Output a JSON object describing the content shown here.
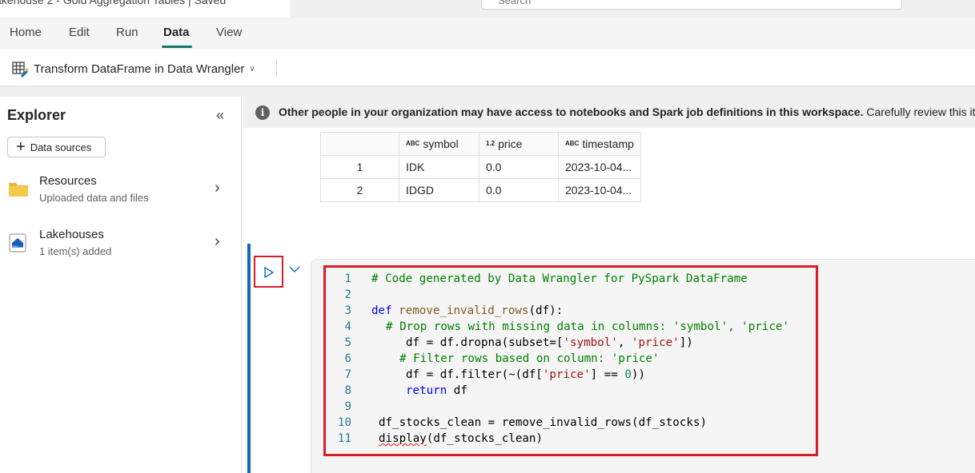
{
  "window": {
    "title_partial": "akehouse 2 - Gold Aggregation Tables | Saved",
    "search_placeholder": "Search"
  },
  "menu": {
    "tabs": [
      "Home",
      "Edit",
      "Run",
      "Data",
      "View"
    ],
    "active": "Data"
  },
  "ribbon": {
    "transform_button": "Transform DataFrame in Data Wrangler"
  },
  "explorer": {
    "title": "Explorer",
    "data_sources_label": "Data sources",
    "items": [
      {
        "label": "Resources",
        "sub": "Uploaded data and files",
        "icon": "folder-icon"
      },
      {
        "label": "Lakehouses",
        "sub": "1 item(s) added",
        "icon": "lakehouse-icon"
      }
    ]
  },
  "infobar": {
    "bold_text": "Other people in your organization may have access to notebooks and Spark job definitions in this workspace.",
    "text": " Carefully review this item before"
  },
  "output_table": {
    "columns": [
      {
        "type": "ABC",
        "name": "symbol"
      },
      {
        "type": "1.2",
        "name": "price"
      },
      {
        "type": "ABC",
        "name": "timestamp"
      }
    ],
    "rows": [
      {
        "index": "1",
        "symbol": "IDK",
        "price": "0.0",
        "timestamp": "2023-10-04..."
      },
      {
        "index": "2",
        "symbol": "IDGD",
        "price": "0.0",
        "timestamp": "2023-10-04..."
      }
    ]
  },
  "code": {
    "line_numbers": [
      "1",
      "2",
      "3",
      "4",
      "5",
      "6",
      "7",
      "8",
      "9",
      "10",
      "11"
    ],
    "l1": "# Code generated by Data Wrangler for PySpark DataFrame",
    "l3_kw": "def",
    "l3_fn": "remove_invalid_rows",
    "l3_rest": "(df):",
    "l4": "# Drop rows with missing data in columns: 'symbol', 'price'",
    "l5_a": "df = df.dropna(subset=[",
    "l5_s1": "'symbol'",
    "l5_b": ", ",
    "l5_s2": "'price'",
    "l5_c": "])",
    "l6": "# Filter rows based on column: 'price'",
    "l7_a": "df = df.filter(~(df[",
    "l7_s": "'price'",
    "l7_b": "] == ",
    "l7_n": "0",
    "l7_c": "))",
    "l8_kw": "return",
    "l8_rest": " df",
    "l10": "df_stocks_clean = remove_invalid_rows(df_stocks)",
    "l11_fn": "display",
    "l11_rest": "(df_stocks_clean)"
  },
  "colors": {
    "accent": "#117865",
    "highlight_red": "#d91e2a",
    "cell_bar": "#0f6cbd"
  }
}
